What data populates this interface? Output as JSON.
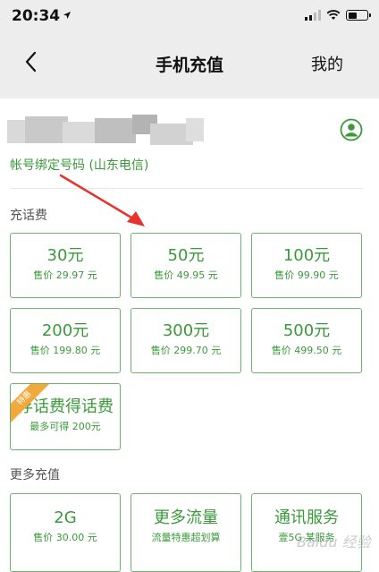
{
  "status_bar": {
    "time": "20:34"
  },
  "nav": {
    "title": "手机充值",
    "right_label": "我的"
  },
  "account": {
    "label": "帐号绑定号码 (山东电信)"
  },
  "recharge": {
    "title": "充话费",
    "items": [
      {
        "amount": "30元",
        "price": "售价 29.97 元"
      },
      {
        "amount": "50元",
        "price": "售价 49.95 元"
      },
      {
        "amount": "100元",
        "price": "售价 99.90 元"
      },
      {
        "amount": "200元",
        "price": "售价 199.80 元"
      },
      {
        "amount": "300元",
        "price": "售价 299.70 元"
      },
      {
        "amount": "500元",
        "price": "售价 499.50 元"
      }
    ],
    "promo": {
      "badge": "特惠",
      "title": "存话费得话费",
      "subtitle": "最多可得 200元"
    }
  },
  "more": {
    "title": "更多充值",
    "items": [
      {
        "title": "2G",
        "subtitle": "售价 30.00 元"
      },
      {
        "title": "更多流量",
        "subtitle": "流量特惠超划算"
      },
      {
        "title": "通讯服务",
        "subtitle": "壹5G 某服务"
      }
    ]
  },
  "watermark": "Baidu 经验",
  "colors": {
    "accent": "#3a9a3a",
    "card_border": "#6bb46b",
    "header_bg": "#ededed",
    "promo": "#f2a93b",
    "annotation_arrow": "#e8322d"
  }
}
